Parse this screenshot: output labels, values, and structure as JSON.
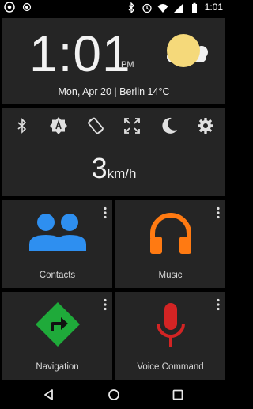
{
  "status_bar": {
    "time": "1:01",
    "left_icons": [
      "chrome-icon",
      "location-icon"
    ],
    "right_icons": [
      "bluetooth-icon",
      "alarm-icon",
      "wifi-icon",
      "signal-icon",
      "battery-icon"
    ]
  },
  "clock": {
    "time": "1:01",
    "ampm": "PM",
    "date_line": "Mon, Apr 20 | Berlin 14°C",
    "weather_icon": "sun-cloud-icon"
  },
  "toggles": [
    {
      "name": "bluetooth-toggle",
      "icon": "bluetooth-icon"
    },
    {
      "name": "brightness-toggle",
      "icon": "auto-brightness-icon"
    },
    {
      "name": "rotation-toggle",
      "icon": "screen-rotation-icon"
    },
    {
      "name": "fullscreen-toggle",
      "icon": "fullscreen-icon"
    },
    {
      "name": "night-mode-toggle",
      "icon": "moon-icon"
    },
    {
      "name": "settings-toggle",
      "icon": "gear-icon"
    }
  ],
  "speed": {
    "value": "3",
    "unit": "km/h"
  },
  "tiles": [
    {
      "label": "Contacts",
      "icon": "contacts-icon",
      "color": "#2e8ff0"
    },
    {
      "label": "Music",
      "icon": "headphones-icon",
      "color": "#ff7a12"
    },
    {
      "label": "Navigation",
      "icon": "navigation-icon",
      "color": "#1faa3a"
    },
    {
      "label": "Voice Command",
      "icon": "microphone-icon",
      "color": "#d32424"
    }
  ],
  "nav_bar": [
    "back-icon",
    "home-icon",
    "recents-icon"
  ]
}
